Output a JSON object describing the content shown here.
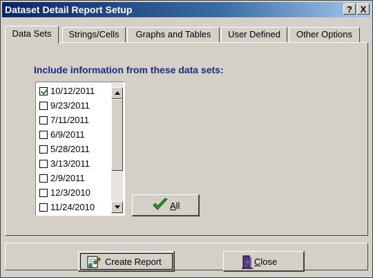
{
  "window": {
    "title": "Dataset Detail Report Setup",
    "help_button": "?",
    "close_button": "X"
  },
  "tabs": [
    {
      "label": "Data Sets",
      "active": true
    },
    {
      "label": "Strings/Cells",
      "active": false
    },
    {
      "label": "Graphs and Tables",
      "active": false
    },
    {
      "label": "User Defined",
      "active": false
    },
    {
      "label": "Other Options",
      "active": false
    }
  ],
  "panel": {
    "heading": "Include information from these data sets:",
    "datasets": [
      {
        "label": "10/12/2011",
        "checked": true
      },
      {
        "label": "9/23/2011",
        "checked": false
      },
      {
        "label": "7/11/2011",
        "checked": false
      },
      {
        "label": "6/9/2011",
        "checked": false
      },
      {
        "label": "5/28/2011",
        "checked": false
      },
      {
        "label": "3/13/2011",
        "checked": false
      },
      {
        "label": "2/9/2011",
        "checked": false
      },
      {
        "label": "12/3/2010",
        "checked": false
      },
      {
        "label": "11/24/2010",
        "checked": false
      }
    ],
    "all_button": {
      "label_underlined": "A",
      "label_rest": "ll",
      "icon": "check-icon"
    }
  },
  "footer": {
    "create_report": {
      "label": "Create Report",
      "icon": "report-icon"
    },
    "close": {
      "label_underlined": "C",
      "label_rest": "lose",
      "icon": "door-exit-icon"
    }
  },
  "colors": {
    "titlebar_start": "#0a246a",
    "titlebar_end": "#a6caf0",
    "heading": "#1c2b7e",
    "face": "#d4d0c8",
    "check_green": "#1f7a2a"
  }
}
